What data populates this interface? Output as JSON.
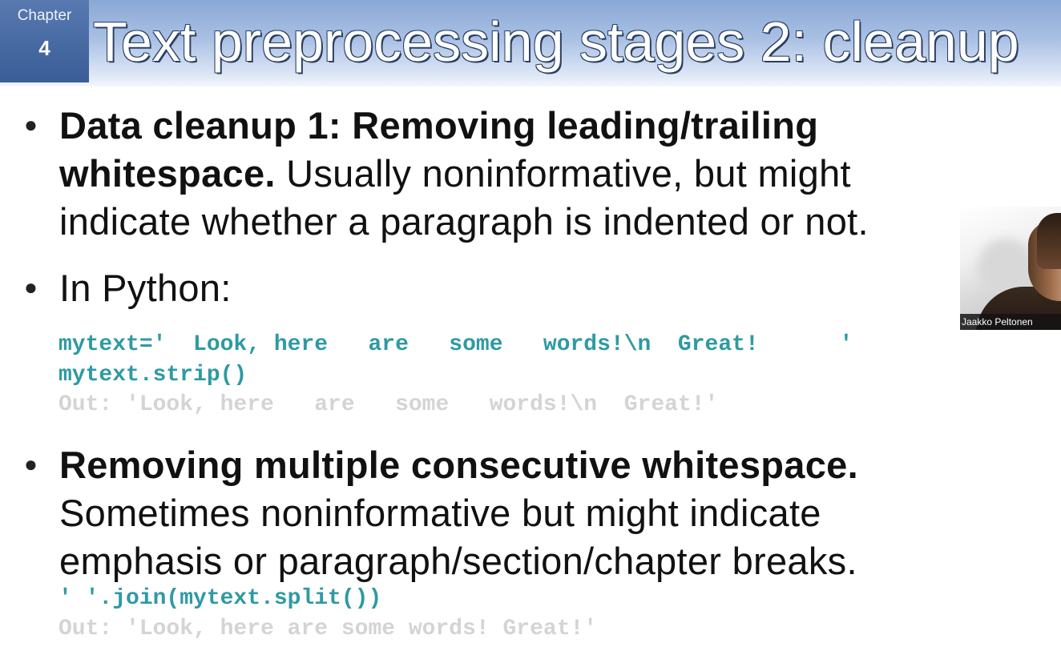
{
  "slide": {
    "chapter_label": "Chapter",
    "chapter_number": "4",
    "title": "Text preprocessing stages 2: cleanup"
  },
  "bullets": [
    {
      "bold": "Data cleanup 1: Removing leading/trailing whitespace.",
      "line1_bold": "Data cleanup 1: Removing leading/trailing",
      "line2_bold": "whitespace.",
      "line2_rest": " Usually noninformative, but might",
      "line3": "indicate whether a paragraph is indented or not."
    },
    {
      "text": "In Python:"
    },
    {
      "line1_bold": "Removing multiple consecutive whitespace.",
      "line2": "Sometimes noninformative but might indicate",
      "line3": "emphasis or paragraph/section/chapter breaks."
    }
  ],
  "code": {
    "strip_assign": "mytext='  Look, here   are   some   words!\\n  Great!      '",
    "strip_call": "mytext.strip()",
    "strip_out": "Out: 'Look, here   are   some   words!\\n  Great!'",
    "join_call": "' '.join(mytext.split())",
    "join_out": "Out: 'Look, here are some words! Great!'"
  },
  "participant": {
    "name": "Jaakko Peltonen"
  },
  "colors": {
    "code": "#2e9aa3",
    "output": "#d4d4d4",
    "chapter_box": "#3a5d97"
  }
}
